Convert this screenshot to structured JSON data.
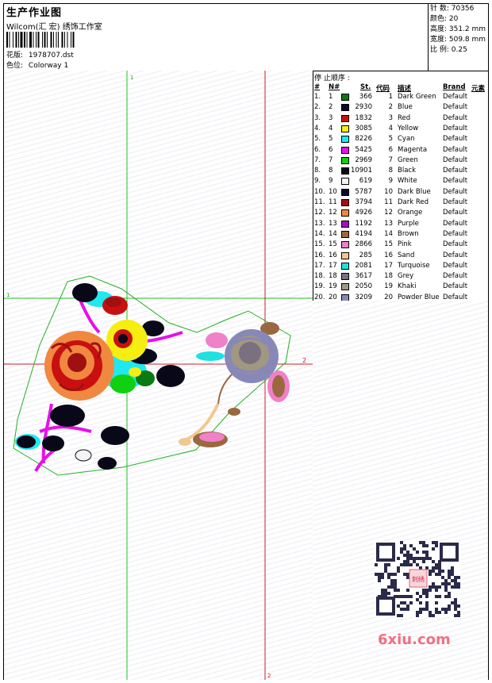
{
  "header": {
    "title": "生产作业图",
    "company": "Wilcom(汇 宏) 绣饰工作室",
    "pattern_label": "花版:",
    "pattern_value": "1978707.dst",
    "colorway_label": "色位:",
    "colorway_value": "Colorway 1"
  },
  "stats": {
    "stitches": "针 数:  70356",
    "colors": "颜色:  20",
    "height": "高度:  351.2 mm",
    "width": "宽度:  509.8 mm",
    "scale": "比 例:  0.25"
  },
  "table": {
    "title": "停 止顺序 :",
    "headers": {
      "num": "#",
      "n": "N#",
      "st": "St.",
      "code": "代码",
      "desc": "描述",
      "brand": "Brand",
      "elem": "元素"
    },
    "rows": [
      {
        "num": "1.",
        "n": "1",
        "color": "#0a7a12",
        "st": "366",
        "code": "1",
        "desc": "Dark Green",
        "brand": "Default"
      },
      {
        "num": "2.",
        "n": "2",
        "color": "#0a0a28",
        "st": "2930",
        "code": "2",
        "desc": "Blue",
        "brand": "Default"
      },
      {
        "num": "3.",
        "n": "3",
        "color": "#c81010",
        "st": "1832",
        "code": "3",
        "desc": "Red",
        "brand": "Default"
      },
      {
        "num": "4.",
        "n": "4",
        "color": "#f5ee10",
        "st": "3085",
        "code": "4",
        "desc": "Yellow",
        "brand": "Default"
      },
      {
        "num": "5.",
        "n": "5",
        "color": "#20e8f0",
        "st": "8226",
        "code": "5",
        "desc": "Cyan",
        "brand": "Default"
      },
      {
        "num": "6.",
        "n": "6",
        "color": "#e810e8",
        "st": "5425",
        "code": "6",
        "desc": "Magenta",
        "brand": "Default"
      },
      {
        "num": "7.",
        "n": "7",
        "color": "#10d010",
        "st": "2969",
        "code": "7",
        "desc": "Green",
        "brand": "Default"
      },
      {
        "num": "8.",
        "n": "8",
        "color": "#080818",
        "st": "10901",
        "code": "8",
        "desc": "Black",
        "brand": "Default"
      },
      {
        "num": "9.",
        "n": "9",
        "color": "#f4f4f4",
        "st": "619",
        "code": "9",
        "desc": "White",
        "brand": "Default"
      },
      {
        "num": "10.",
        "n": "10",
        "color": "#0c0c30",
        "st": "5787",
        "code": "10",
        "desc": "Dark Blue",
        "brand": "Default"
      },
      {
        "num": "11.",
        "n": "11",
        "color": "#a01010",
        "st": "3794",
        "code": "11",
        "desc": "Dark Red",
        "brand": "Default"
      },
      {
        "num": "12.",
        "n": "12",
        "color": "#f08840",
        "st": "4926",
        "code": "12",
        "desc": "Orange",
        "brand": "Default"
      },
      {
        "num": "13.",
        "n": "13",
        "color": "#a010c0",
        "st": "1192",
        "code": "13",
        "desc": "Purple",
        "brand": "Default"
      },
      {
        "num": "14.",
        "n": "14",
        "color": "#9a6840",
        "st": "4194",
        "code": "14",
        "desc": "Brown",
        "brand": "Default"
      },
      {
        "num": "15.",
        "n": "15",
        "color": "#f080c8",
        "st": "2866",
        "code": "15",
        "desc": "Pink",
        "brand": "Default"
      },
      {
        "num": "16.",
        "n": "16",
        "color": "#f0c890",
        "st": "285",
        "code": "16",
        "desc": "Sand",
        "brand": "Default"
      },
      {
        "num": "17.",
        "n": "17",
        "color": "#20e0e0",
        "st": "2081",
        "code": "17",
        "desc": "Turquoise",
        "brand": "Default"
      },
      {
        "num": "18.",
        "n": "18",
        "color": "#7a7080",
        "st": "3617",
        "code": "18",
        "desc": "Grey",
        "brand": "Default"
      },
      {
        "num": "19.",
        "n": "19",
        "color": "#a09880",
        "st": "2050",
        "code": "19",
        "desc": "Khaki",
        "brand": "Default"
      },
      {
        "num": "20.",
        "n": "20",
        "color": "#8888b8",
        "st": "3209",
        "code": "20",
        "desc": "Powder Blue",
        "brand": "Default"
      }
    ]
  },
  "guides": {
    "v1": "1",
    "h1": "1",
    "h2": "2",
    "v2": "2"
  },
  "watermark": {
    "site": "6xiu.com",
    "qr_center_text": "刺绣"
  }
}
